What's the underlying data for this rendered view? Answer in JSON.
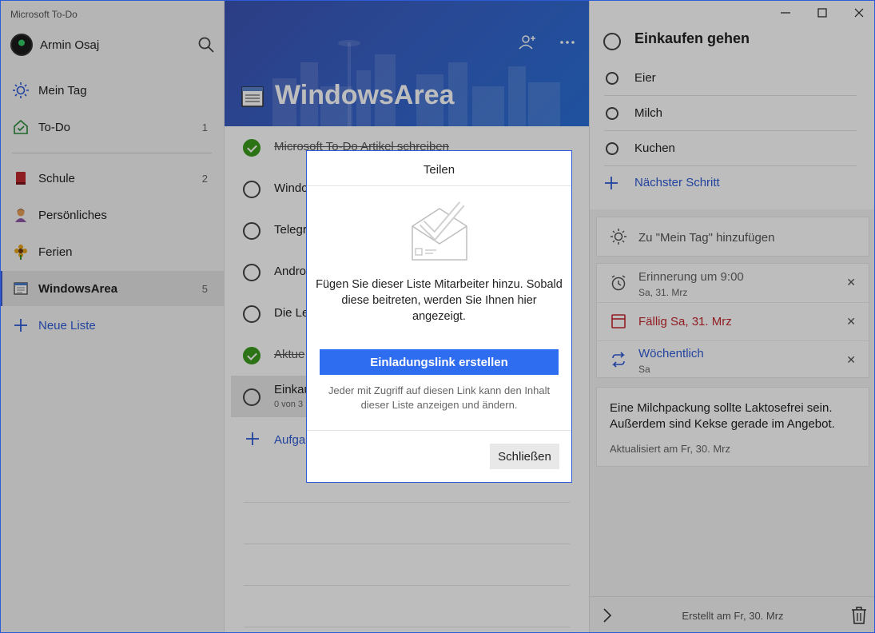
{
  "app": {
    "title": "Microsoft To-Do"
  },
  "user": {
    "name": "Armin Osaj"
  },
  "sidebar": {
    "items": [
      {
        "label": "Mein Tag",
        "count": ""
      },
      {
        "label": "To-Do",
        "count": "1"
      },
      {
        "label": "Schule",
        "count": "2"
      },
      {
        "label": "Persönliches",
        "count": ""
      },
      {
        "label": "Ferien",
        "count": ""
      },
      {
        "label": "WindowsArea",
        "count": "5"
      }
    ],
    "new_list": "Neue Liste"
  },
  "list": {
    "title": "WindowsArea",
    "tasks": [
      {
        "text": "Microsoft To-Do Artikel schreiben",
        "done": true,
        "sub": ""
      },
      {
        "text": "Windo",
        "done": false,
        "sub": ""
      },
      {
        "text": "Telegr",
        "done": false,
        "sub": ""
      },
      {
        "text": "Andro",
        "done": false,
        "sub": ""
      },
      {
        "text": "Die Le",
        "done": false,
        "sub": ""
      },
      {
        "text": "Aktue",
        "done": true,
        "sub": ""
      },
      {
        "text": "Einkau",
        "done": false,
        "sub": "0 von 3"
      }
    ],
    "add_task": "Aufgal"
  },
  "detail": {
    "title": "Einkaufen gehen",
    "steps": [
      "Eier",
      "Milch",
      "Kuchen"
    ],
    "next_step": "Nächster Schritt",
    "my_day": "Zu \"Mein Tag\" hinzufügen",
    "reminder": {
      "title": "Erinnerung um 9:00",
      "sub": "Sa, 31. Mrz"
    },
    "due": {
      "title": "Fällig Sa, 31. Mrz"
    },
    "repeat": {
      "title": "Wöchentlich",
      "sub": "Sa"
    },
    "note": "Eine Milchpackung sollte Laktosefrei sein. Außerdem sind Kekse gerade im Angebot.",
    "note_updated": "Aktualisiert am Fr, 30. Mrz",
    "created": "Erstellt am Fr, 30. Mrz"
  },
  "modal": {
    "title": "Teilen",
    "message": "Fügen Sie dieser Liste Mitarbeiter hinzu. Sobald diese beitreten, werden Sie Ihnen hier angezeigt.",
    "invite_button": "Einladungslink erstellen",
    "hint": "Jeder mit Zugriff auf diesen Link kann den Inhalt dieser Liste anzeigen und ändern.",
    "close_button": "Schließen"
  },
  "colors": {
    "accent": "#2e6cf0",
    "check_done": "#3c9c1e",
    "due_red": "#c4262e",
    "link_blue": "#2e5bd6"
  },
  "icons": [
    "search-icon",
    "sun-icon",
    "home-icon",
    "book-icon",
    "person-icon",
    "flower-icon",
    "list-icon",
    "plus-icon",
    "add-person-icon",
    "more-icon",
    "alarm-icon",
    "calendar-icon",
    "repeat-icon",
    "close-icon",
    "chevron-right-icon",
    "trash-icon",
    "envelope-check-icon"
  ]
}
